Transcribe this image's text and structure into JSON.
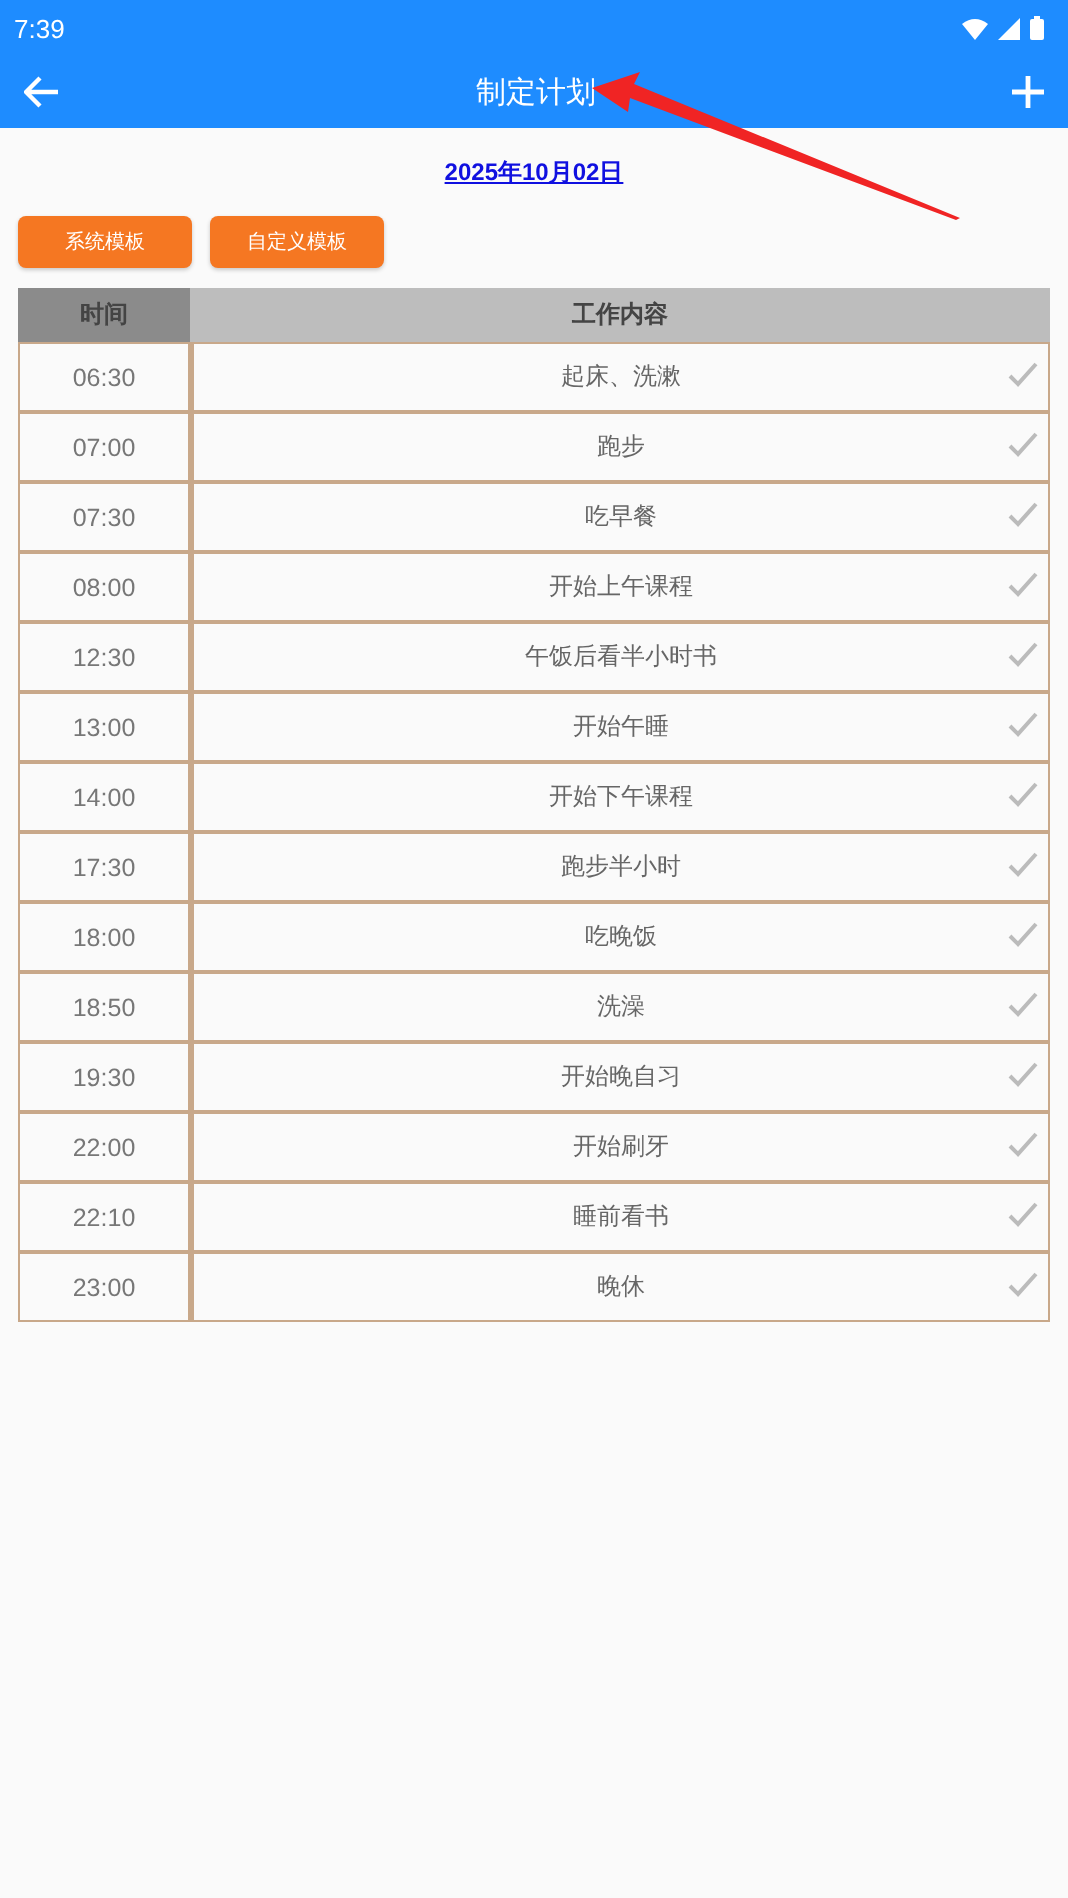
{
  "status_bar": {
    "time": "7:39"
  },
  "app_bar": {
    "title": "制定计划"
  },
  "date": "2025年10月02日",
  "template_buttons": [
    "系统模板",
    "自定义模板"
  ],
  "table": {
    "columns": [
      "时间",
      "工作内容"
    ],
    "rows": [
      {
        "time": "06:30",
        "task": "起床、洗漱"
      },
      {
        "time": "07:00",
        "task": "跑步"
      },
      {
        "time": "07:30",
        "task": "吃早餐"
      },
      {
        "time": "08:00",
        "task": "开始上午课程"
      },
      {
        "time": "12:30",
        "task": "午饭后看半小时书"
      },
      {
        "time": "13:00",
        "task": "开始午睡"
      },
      {
        "time": "14:00",
        "task": "开始下午课程"
      },
      {
        "time": "17:30",
        "task": "跑步半小时"
      },
      {
        "time": "18:00",
        "task": "吃晚饭"
      },
      {
        "time": "18:50",
        "task": "洗澡"
      },
      {
        "time": "19:30",
        "task": "开始晚自习"
      },
      {
        "time": "22:00",
        "task": "开始刷牙"
      },
      {
        "time": "22:10",
        "task": "睡前看书"
      },
      {
        "time": "23:00",
        "task": "晚休"
      }
    ]
  }
}
